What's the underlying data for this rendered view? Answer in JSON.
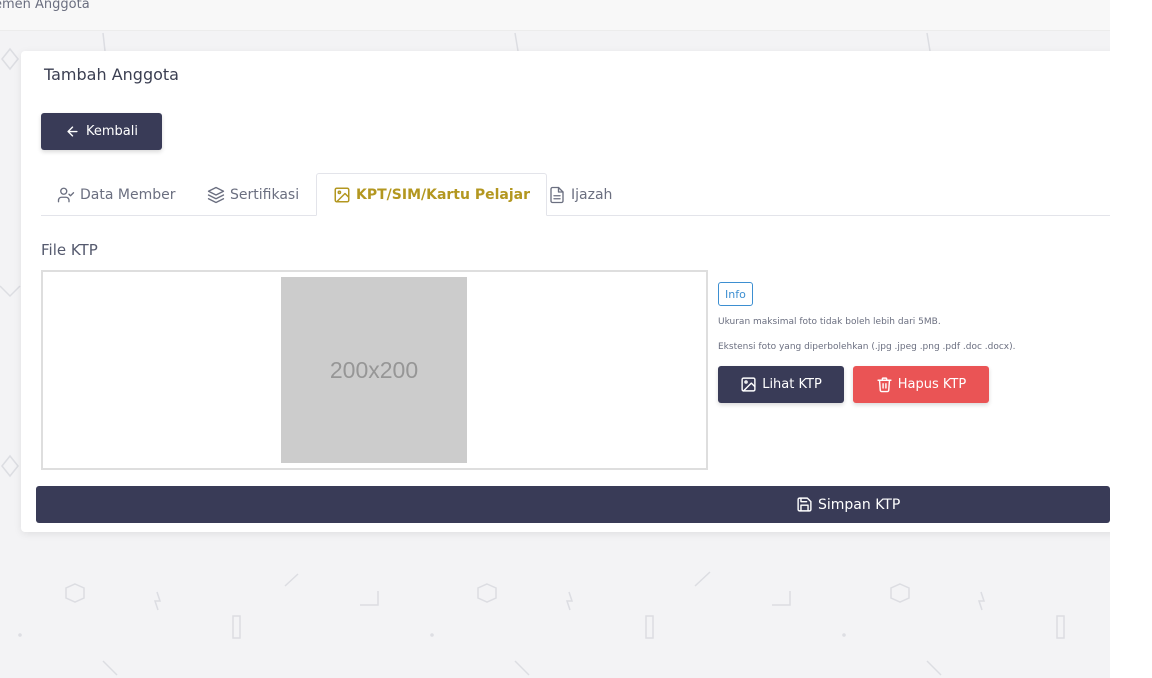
{
  "breadcrumb": {
    "current": "emen Anggota"
  },
  "card": {
    "title": "Tambah Anggota"
  },
  "back_button": {
    "label": "Kembali",
    "icon": "arrow-left-icon"
  },
  "tabs": [
    {
      "label": "Data Member",
      "icon": "user-check-icon",
      "active": false
    },
    {
      "label": "Sertifikasi",
      "icon": "layers-icon",
      "active": false
    },
    {
      "label": "KPT/SIM/Kartu Pelajar",
      "icon": "image-icon",
      "active": true
    },
    {
      "label": "Ijazah",
      "icon": "file-text-icon",
      "active": false
    }
  ],
  "file_section": {
    "label": "File KTP",
    "placeholder_text": "200x200",
    "info_badge": "Info",
    "help_size": "Ukuran maksimal foto tidak boleh lebih dari 5MB.",
    "help_ext": "Ekstensi foto yang diperbolehkan (.jpg .jpeg .png .pdf .doc .docx)."
  },
  "actions": {
    "view_label": "Lihat KTP",
    "delete_label": "Hapus KTP",
    "save_label": "Simpan KTP"
  },
  "colors": {
    "primary": "#393b57",
    "danger": "#ea5455",
    "active_tab": "#b39720",
    "info": "#3d8fd1"
  }
}
